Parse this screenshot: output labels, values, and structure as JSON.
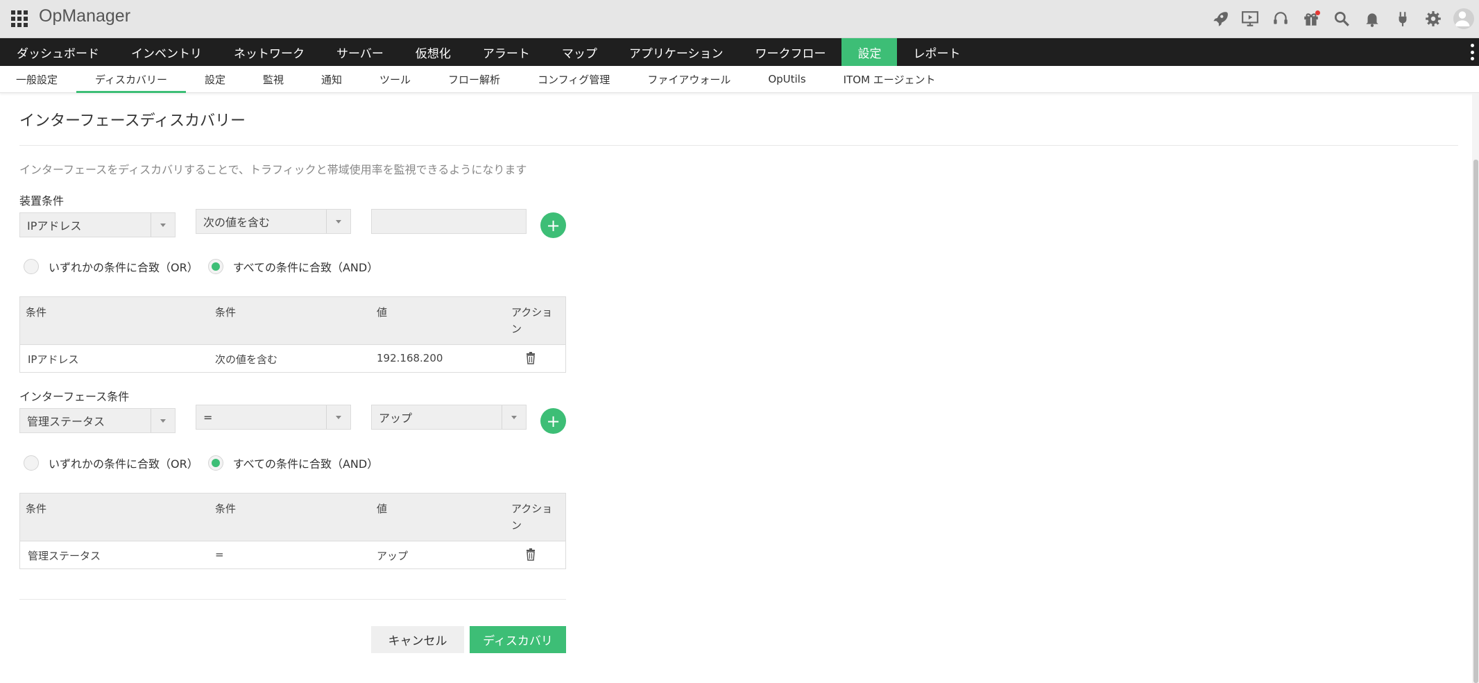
{
  "app": {
    "title": "OpManager"
  },
  "main_nav": {
    "items": [
      {
        "label": "ダッシュボード"
      },
      {
        "label": "インベントリ"
      },
      {
        "label": "ネットワーク"
      },
      {
        "label": "サーバー"
      },
      {
        "label": "仮想化"
      },
      {
        "label": "アラート"
      },
      {
        "label": "マップ"
      },
      {
        "label": "アプリケーション"
      },
      {
        "label": "ワークフロー"
      },
      {
        "label": "設定",
        "active": true
      },
      {
        "label": "レポート"
      }
    ]
  },
  "sub_nav": {
    "items": [
      {
        "label": "一般設定"
      },
      {
        "label": "ディスカバリー",
        "active": true
      },
      {
        "label": "設定"
      },
      {
        "label": "監視"
      },
      {
        "label": "通知"
      },
      {
        "label": "ツール"
      },
      {
        "label": "フロー解析"
      },
      {
        "label": "コンフィグ管理"
      },
      {
        "label": "ファイアウォール"
      },
      {
        "label": "OpUtils"
      },
      {
        "label": "ITOM エージェント"
      }
    ]
  },
  "top_icons": [
    "rocket-icon",
    "presentation-icon",
    "headset-icon",
    "gift-icon",
    "search-icon",
    "bell-icon",
    "plug-icon",
    "gear-icon",
    "avatar"
  ],
  "page": {
    "title": "インターフェースディスカバリー",
    "description": "インターフェースをディスカバリすることで、トラフィックと帯域使用率を監視できるようになります"
  },
  "device_criteria": {
    "label": "装置条件",
    "field_select": "IPアドレス",
    "operator_select": "次の値を含む",
    "value_input": "",
    "radio_or": "いずれかの条件に合致（OR）",
    "radio_and": "すべての条件に合致（AND）",
    "selected": "and",
    "table": {
      "headers": [
        "条件",
        "条件",
        "値",
        "アクション"
      ],
      "rows": [
        [
          "IPアドレス",
          "次の値を含む",
          "192.168.200"
        ]
      ]
    }
  },
  "interface_criteria": {
    "label": "インターフェース条件",
    "field_select": "管理ステータス",
    "operator_select": "=",
    "value_select": "アップ",
    "radio_or": "いずれかの条件に合致（OR）",
    "radio_and": "すべての条件に合致（AND）",
    "selected": "and",
    "table": {
      "headers": [
        "条件",
        "条件",
        "値",
        "アクション"
      ],
      "rows": [
        [
          "管理ステータス",
          "=",
          "アップ"
        ]
      ]
    }
  },
  "actions": {
    "cancel": "キャンセル",
    "discover": "ディスカバリ"
  },
  "colors": {
    "accent": "#3dbe76",
    "nav_bg": "#1f1f1f",
    "header_bg": "#e6e6e6"
  }
}
